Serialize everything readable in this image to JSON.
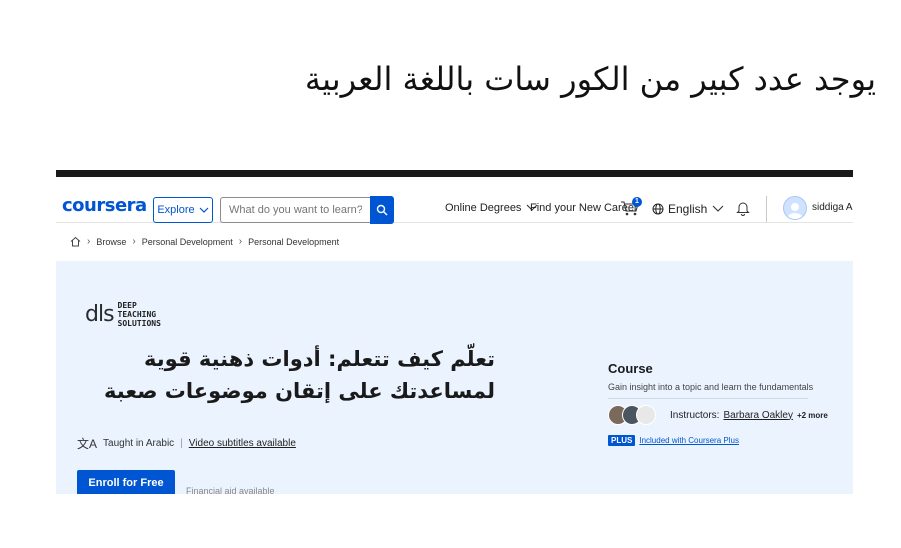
{
  "headline": "يوجد عدد كبير من الكور سات باللغة العربية",
  "header": {
    "logo": "coursera",
    "explore_label": "Explore",
    "search_placeholder": "What do you want to learn?",
    "nav_online_degrees": "Online Degrees",
    "nav_find_career": "Find your New Career",
    "cart_badge_count": "1",
    "language_label": "English",
    "user_name": "siddiga Ali"
  },
  "breadcrumb": [
    "Browse",
    "Personal Development",
    "Personal Development"
  ],
  "course": {
    "partner_mark": "dls",
    "partner_line1": "DEEP",
    "partner_line2": "TEACHING",
    "partner_line3": "SOLUTIONS",
    "title": "تعلّم كيف تتعلم: أدوات ذهنية قوية لمساعدتك على إتقان موضوعات صعبة",
    "taught_in": "Taught in Arabic",
    "subtitles": "Video subtitles available",
    "enroll_label": "Enroll for Free",
    "enroll_side_text": "Financial aid available"
  },
  "info_card": {
    "type": "Course",
    "description": "Gain insight into a topic and learn the fundamentals",
    "instructors_label": "Instructors:",
    "instructor_name": "Barbara Oakley",
    "instructors_more": "+2 more",
    "plus_badge": "PLUS",
    "plus_text": "Included with Coursera Plus"
  },
  "colors": {
    "brand_blue": "#0056d2",
    "hero_bg": "#ebf3ff"
  }
}
